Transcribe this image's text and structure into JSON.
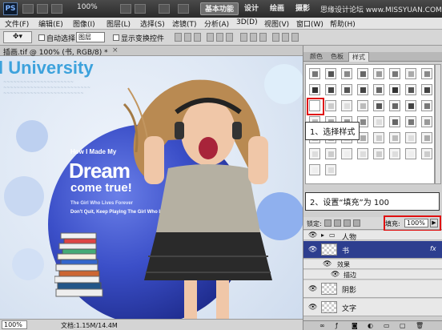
{
  "app": {
    "logo": "PS",
    "zoom_display": "100%",
    "workspaces": [
      "基本功能",
      "设计",
      "绘画",
      "摄影"
    ],
    "watermark": "思缘设计论坛 www.MISSYUAN.COM"
  },
  "menu": [
    "文件(F)",
    "编辑(E)",
    "图像(I)",
    "图层(L)",
    "选择(S)",
    "滤镜(T)",
    "分析(A)",
    "3D(D)",
    "视图(V)",
    "窗口(W)",
    "帮助(H)"
  ],
  "options": {
    "auto_select_label": "自动选择:",
    "auto_select_value": "图层",
    "show_transform_label": "显示变换控件"
  },
  "document": {
    "tab_label": "插画.tif @ 100% (书, RGB/8) *",
    "tab_close": "×",
    "zoom": "100%",
    "doc_info": "文档:1.15M/14.4M"
  },
  "artwork": {
    "university": "l University",
    "how": "How I Made My",
    "dream": "Dream",
    "come_true": "come true!",
    "girl_who": "The Girl Who Lives Forever",
    "dont_quit": "Don't Quit, Keep Playing The Girl Who Live"
  },
  "panels": {
    "tabs": [
      "颜色",
      "色板",
      "样式"
    ],
    "active_tab": "样式",
    "callout1": "1、选择样式",
    "callout2": "2、设置“填充”为 100"
  },
  "layers": {
    "lock_label": "锁定:",
    "fill_label": "填充:",
    "fill_value": "100%",
    "fill_arrow": "▶",
    "items": [
      {
        "name": "人物",
        "type": "group"
      },
      {
        "name": "书",
        "type": "layer",
        "fx": "fx"
      },
      {
        "name": "效果",
        "type": "effects"
      },
      {
        "name": "描边",
        "type": "effect"
      },
      {
        "name": "阴影",
        "type": "layer"
      },
      {
        "name": "文字",
        "type": "layer"
      }
    ]
  },
  "colors": {
    "accent": "#2d3e8f",
    "highlight_red": "#e01010",
    "title_blue": "#3da2dc"
  }
}
